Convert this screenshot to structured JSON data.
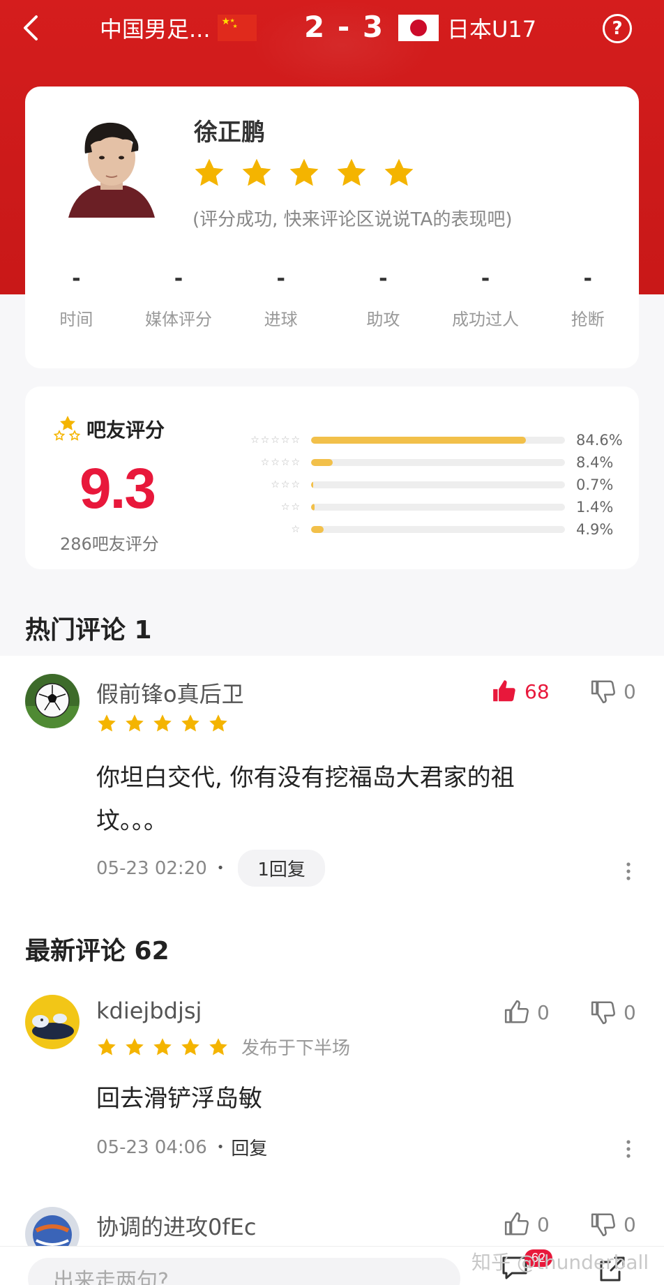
{
  "header": {
    "home_team": "中国男足...",
    "score": "2 - 3",
    "away_team": "日本U17",
    "help_label": "?"
  },
  "player": {
    "name": "徐正鹏",
    "stars_filled": 5,
    "rate_hint": "(评分成功, 快来评论区说说TA的表现吧)",
    "stats": [
      {
        "value": "-",
        "label": "时间"
      },
      {
        "value": "-",
        "label": "媒体评分"
      },
      {
        "value": "-",
        "label": "进球"
      },
      {
        "value": "-",
        "label": "助攻"
      },
      {
        "value": "-",
        "label": "成功过人"
      },
      {
        "value": "-",
        "label": "抢断"
      }
    ]
  },
  "rating": {
    "title": "吧友评分",
    "score": "9.3",
    "count_label": "286吧友评分",
    "distribution": [
      {
        "stars": "☆☆☆☆☆",
        "percent": 84.6,
        "label": "84.6%"
      },
      {
        "stars": "☆☆☆☆",
        "percent": 8.4,
        "label": "8.4%"
      },
      {
        "stars": "☆☆☆",
        "percent": 0.7,
        "label": "0.7%"
      },
      {
        "stars": "☆☆",
        "percent": 1.4,
        "label": "1.4%"
      },
      {
        "stars": "☆",
        "percent": 4.9,
        "label": "4.9%"
      }
    ]
  },
  "hot_comments": {
    "title": "热门评论 1",
    "items": [
      {
        "user": "假前锋o真后卫",
        "stars": 5,
        "likes": "68",
        "dislikes": "0",
        "text": "你坦白交代, 你有没有挖福岛大君家的祖坟。。。",
        "time": "05-23 02:20",
        "reply_label": "1回复"
      }
    ]
  },
  "new_comments": {
    "title": "最新评论 62",
    "items": [
      {
        "user": "kdiejbdjsj",
        "stars": 5,
        "posted": "发布于下半场",
        "likes": "0",
        "dislikes": "0",
        "text": "回去滑铲浮岛敏",
        "time": "05-23 04:06",
        "reply_label": "回复"
      },
      {
        "user": "协调的进攻0fEc",
        "likes": "0",
        "dislikes": "0"
      }
    ]
  },
  "bottom": {
    "input_placeholder": "出来走两句?",
    "comment_badge": "62"
  },
  "watermark": "知乎 @thunderball",
  "colors": {
    "header_red": "#cc1a1a",
    "score_red": "#e8183b",
    "star_gold": "#f4b400",
    "bar_gold": "#f2c04a",
    "like_red": "#e8183b"
  },
  "icons": {
    "back": "chevron-left-icon",
    "help": "question-circle-icon",
    "like": "thumbs-up-icon",
    "dislike": "thumbs-down-icon",
    "more": "more-vertical-icon",
    "share": "share-icon",
    "comment": "comment-icon"
  }
}
